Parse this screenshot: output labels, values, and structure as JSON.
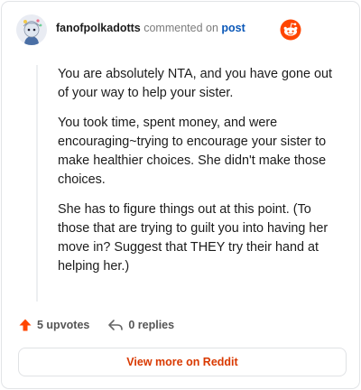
{
  "header": {
    "author": "fanofpolkadotts",
    "action_text": "commented on",
    "post_link": "post",
    "brand_name": "reddit"
  },
  "comment": {
    "paragraphs": [
      "You are absolutely NTA, and you have gone out of your way to help your sister.",
      "You took time, spent money, and were encouraging~trying to encourage your sister to make healthier choices. She didn't make those choices.",
      "She has to figure things out at this point. (To those that are trying to guilt you into having her move in? Suggest that THEY try their hand at helping her.)"
    ]
  },
  "footer": {
    "upvotes_label": "5 upvotes",
    "replies_label": "0 replies",
    "cta_label": "View more on Reddit"
  },
  "colors": {
    "brand_orange": "#ff4500",
    "link_blue": "#0b58b8",
    "cta_text": "#d93900"
  },
  "icons": {
    "avatar": "snoo-avatar",
    "brand": "reddit-logo-icon",
    "upvote": "upvote-arrow-icon",
    "reply": "reply-arrow-icon"
  }
}
